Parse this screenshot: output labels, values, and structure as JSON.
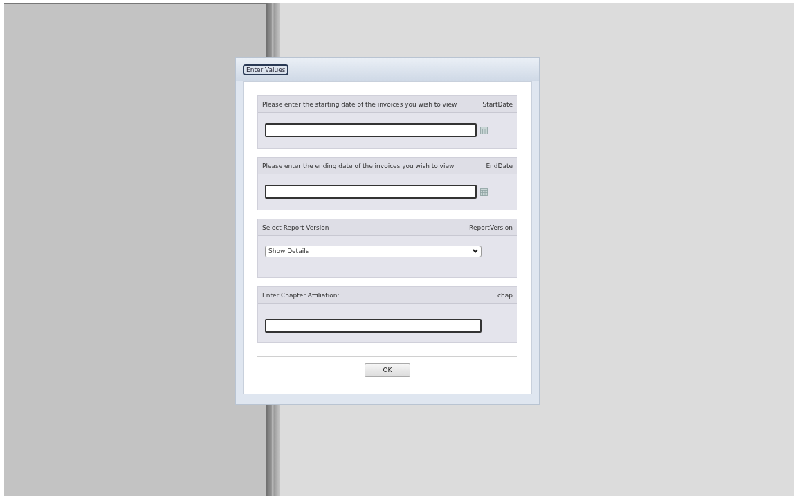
{
  "dialog": {
    "title": "Enter Values",
    "title_focused": true
  },
  "parameters": [
    {
      "kind": "date",
      "prompt": "Please enter the starting date of the invoices you wish to view",
      "name": "StartDate"
    },
    {
      "kind": "date",
      "prompt": "Please enter the ending date of the invoices you wish to view",
      "name": "EndDate"
    },
    {
      "kind": "select",
      "prompt": "Select Report Version",
      "name": "ReportVersion",
      "value": "Show Details"
    },
    {
      "kind": "text",
      "prompt": "Enter Chapter Affiliation:",
      "name": "chap"
    }
  ],
  "buttons": [
    "OK"
  ]
}
